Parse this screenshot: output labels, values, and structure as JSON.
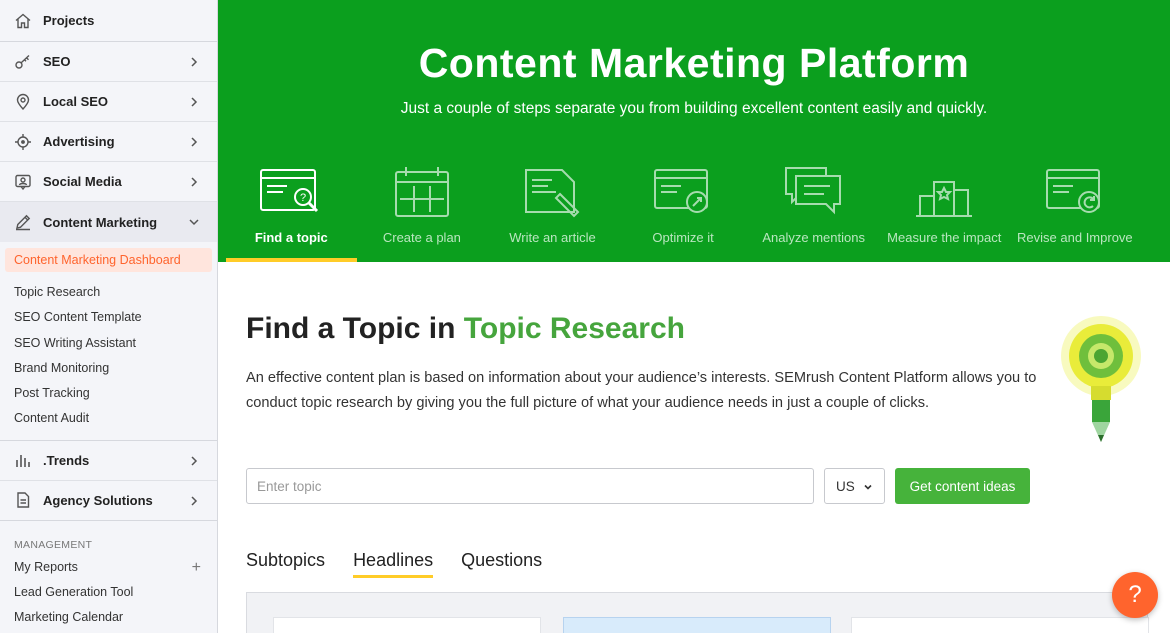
{
  "sidebar": {
    "items": [
      {
        "label": "Projects",
        "icon": "home-icon"
      },
      {
        "label": "SEO",
        "icon": "key-icon"
      },
      {
        "label": "Local SEO",
        "icon": "location-pin-icon"
      },
      {
        "label": "Advertising",
        "icon": "crosshair-icon"
      },
      {
        "label": "Social Media",
        "icon": "social-icon"
      },
      {
        "label": "Content Marketing",
        "icon": "pencil-icon"
      }
    ],
    "content_marketing_sub": [
      "Content Marketing Dashboard",
      "Topic Research",
      "SEO Content Template",
      "SEO Writing Assistant",
      "Brand Monitoring",
      "Post Tracking",
      "Content Audit"
    ],
    "trends": {
      "label": ".Trends",
      "icon": "bar-chart-icon"
    },
    "agency": {
      "label": "Agency Solutions",
      "icon": "document-icon"
    },
    "management": {
      "heading": "MANAGEMENT",
      "items": [
        "My Reports",
        "Lead Generation Tool",
        "Marketing Calendar"
      ]
    }
  },
  "banner": {
    "title": "Content Marketing Platform",
    "subtitle": "Just a couple of steps separate you from building excellent content easily and quickly.",
    "steps": [
      "Find a topic",
      "Create a plan",
      "Write an article",
      "Optimize it",
      "Analyze mentions",
      "Measure the impact",
      "Revise and Improve"
    ],
    "active_step": 0
  },
  "main": {
    "heading_prefix": "Find a Topic in ",
    "heading_highlight": "Topic Research",
    "description": "An effective content plan is based on information about your audience’s interests. SEMrush Content Platform allows you to conduct topic research by giving you the full picture of what your audience needs in just a couple of clicks.",
    "search": {
      "placeholder": "Enter topic",
      "value": ""
    },
    "country": "US",
    "cta_label": "Get content ideas",
    "tabs": [
      "Subtopics",
      "Headlines",
      "Questions"
    ],
    "active_tab": 1
  },
  "help_label": "?",
  "colors": {
    "banner_green": "#0b9f1e",
    "highlight_green": "#46a53d",
    "accent_orange": "#ff642d",
    "accent_yellow": "#ffcc28"
  }
}
